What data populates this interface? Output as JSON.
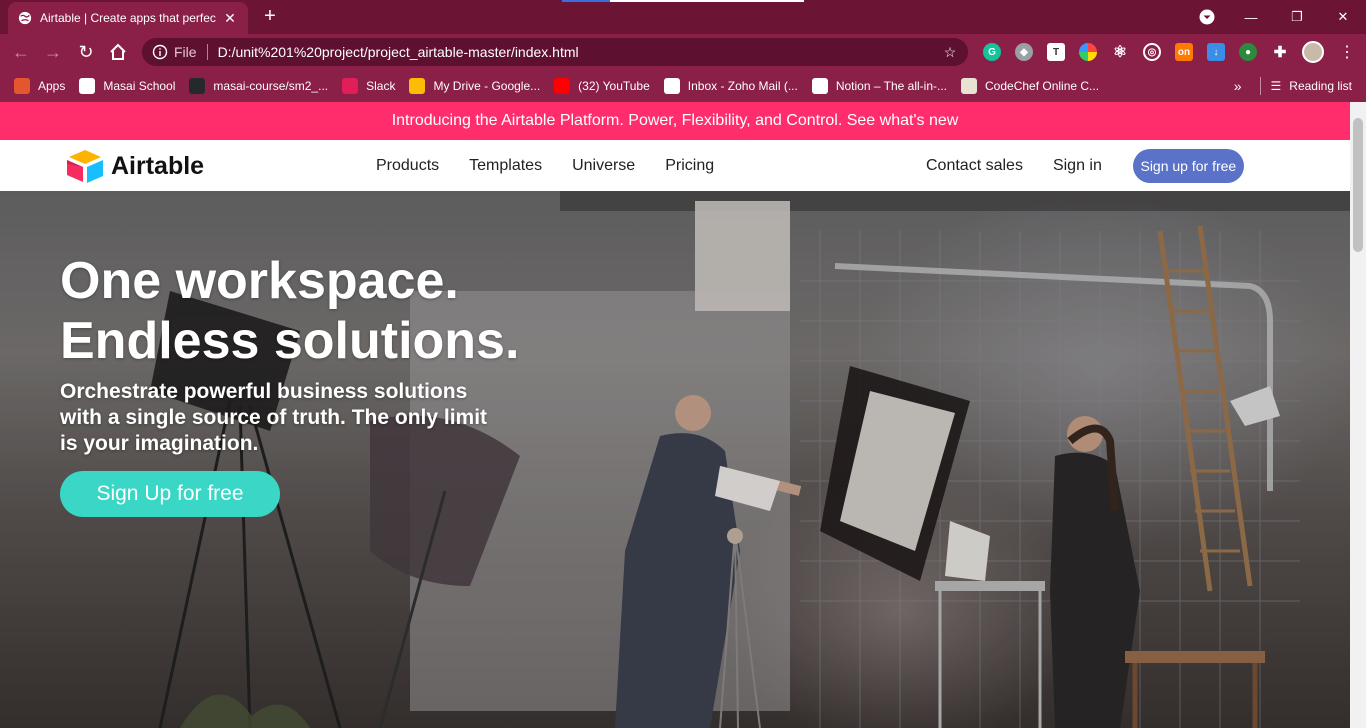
{
  "browser": {
    "tab": {
      "title": "Airtable | Create apps that perfec",
      "close": "✕"
    },
    "new_tab": "+",
    "window_controls": {
      "minimize": "—",
      "restore": "❐",
      "close": "✕"
    },
    "omnibox": {
      "scheme": "File",
      "url": "D:/unit%201%20project/project_airtable-master/index.html"
    },
    "bookmarks": [
      {
        "label": "Apps",
        "icon": "apps-grid-icon",
        "color": "#e4572e"
      },
      {
        "label": "Masai School",
        "icon": "globe-icon",
        "color": "#ffffff"
      },
      {
        "label": "masai-course/sm2_...",
        "icon": "github-icon",
        "color": "#24292e"
      },
      {
        "label": "Slack",
        "icon": "slack-icon",
        "color": "#e01e5a"
      },
      {
        "label": "My Drive - Google...",
        "icon": "google-drive-icon",
        "color": "#fbbc04"
      },
      {
        "label": "(32) YouTube",
        "icon": "youtube-icon",
        "color": "#ff0000"
      },
      {
        "label": "Inbox - Zoho Mail (...",
        "icon": "zoho-mail-icon",
        "color": "#ffffff"
      },
      {
        "label": "Notion – The all-in-...",
        "icon": "notion-icon",
        "color": "#ffffff"
      },
      {
        "label": "CodeChef Online C...",
        "icon": "codechef-icon",
        "color": "#e8e2d0"
      }
    ],
    "bookmarks_more": "»",
    "reading_list": "Reading list"
  },
  "announcement": "Introducing the Airtable Platform. Power, Flexibility, and Control. See what's new",
  "nav": {
    "logo_text": "Airtable",
    "links": [
      "Products",
      "Templates",
      "Universe",
      "Pricing"
    ],
    "contact": "Contact sales",
    "signin": "Sign in",
    "signup": "Sign up for free"
  },
  "hero": {
    "title_line1": "One workspace.",
    "title_line2": "Endless solutions.",
    "subtitle": "Orchestrate powerful business solutions with a single source of truth. The only limit is your imagination.",
    "cta": "Sign Up for free"
  },
  "colors": {
    "chrome": "#8a1f47",
    "announcement_bg": "#ff2d6b",
    "signup_button": "#5a72c8",
    "cta_button": "#3ad6c6"
  }
}
